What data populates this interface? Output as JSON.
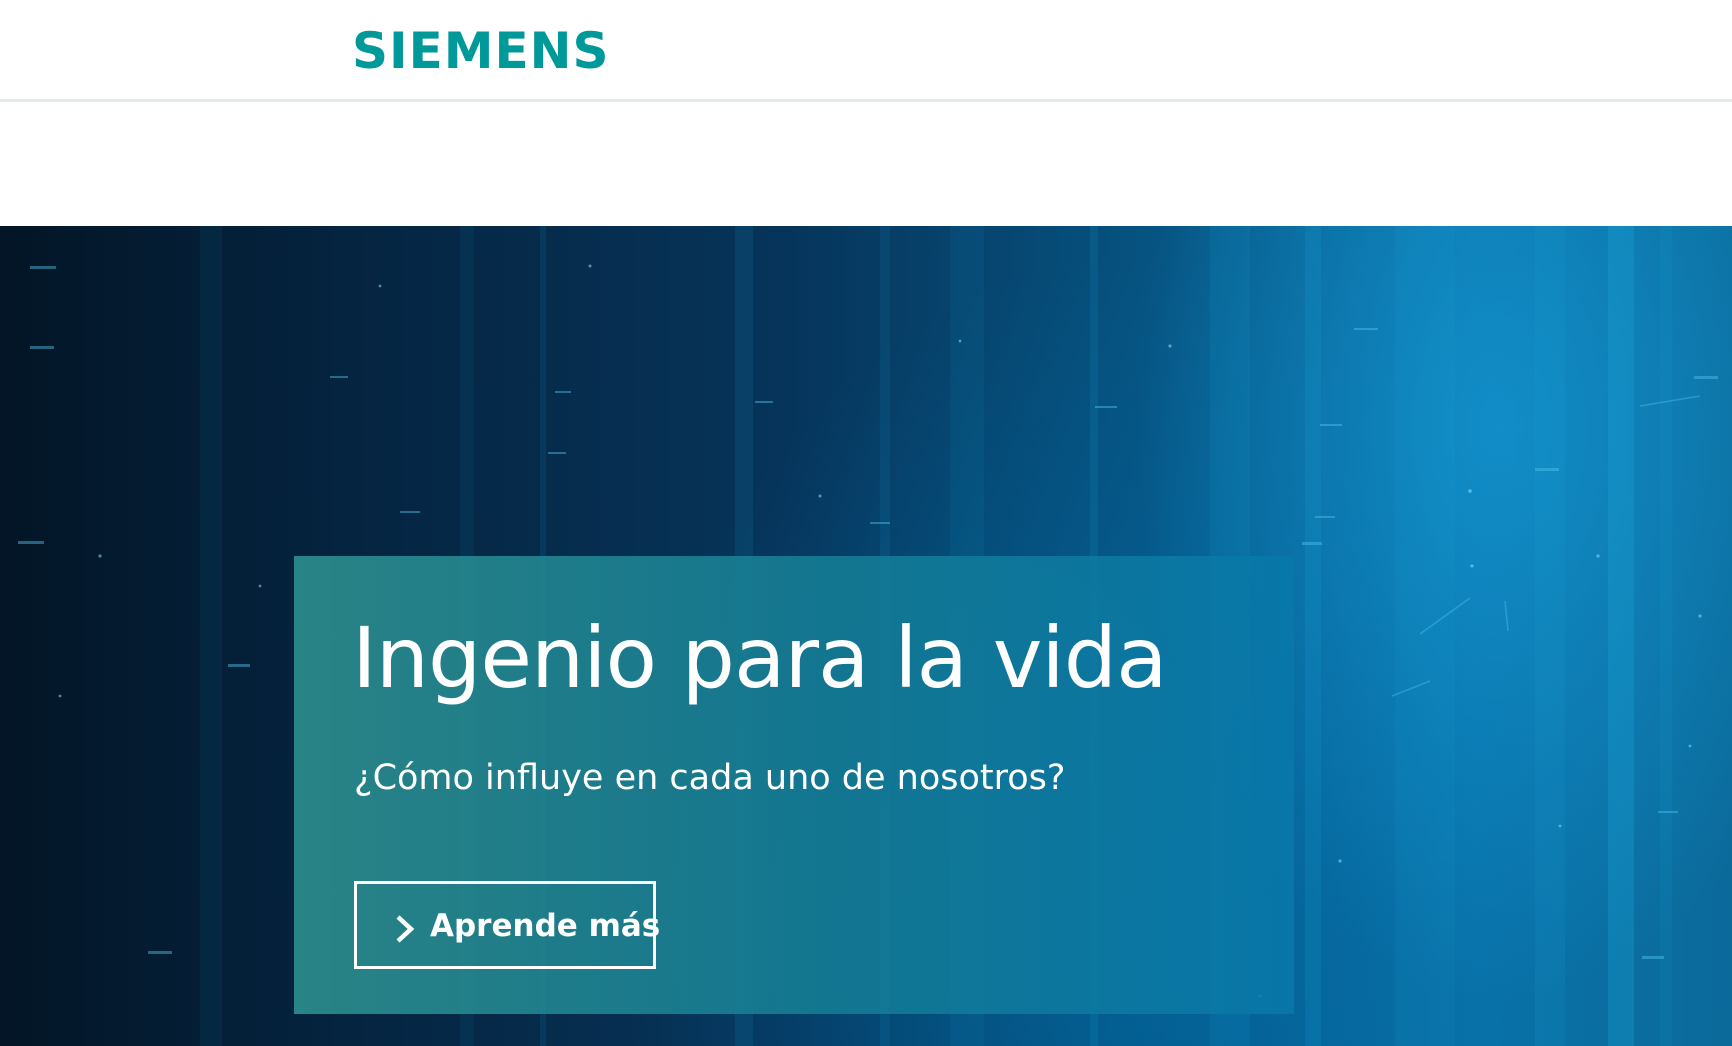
{
  "header": {
    "logo_text": "SIEMENS",
    "logo_color": "#009999"
  },
  "hero": {
    "title": "Ingenio para la vida",
    "subtitle": "¿Cómo influye en cada uno de nosotros?",
    "cta_label": "Aprende más",
    "cta_icon": "chevron-right-icon"
  },
  "colors": {
    "brand": "#009999",
    "hero_dark": "#031526",
    "hero_light": "#0a72a8",
    "teaser_panel": "#2c8c8c",
    "text_on_hero": "#ffffff"
  }
}
